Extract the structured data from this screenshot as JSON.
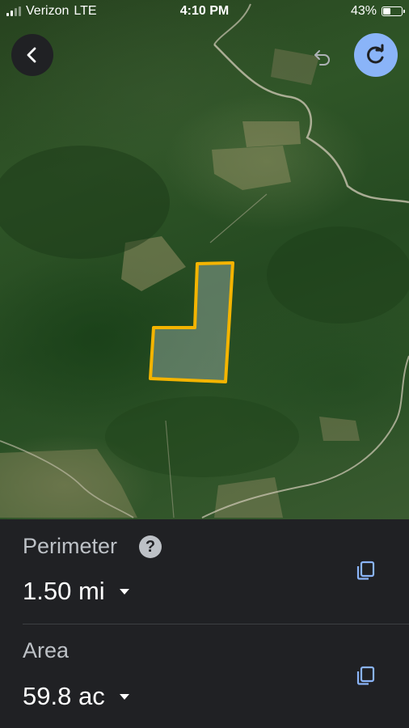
{
  "status_bar": {
    "carrier": "Verizon",
    "network": "LTE",
    "time": "4:10 PM",
    "battery_percent": "43%",
    "battery_level": 0.43,
    "signal_bars": 2
  },
  "toolbar": {
    "back": "back-arrow-icon",
    "undo": "undo-icon",
    "redo": "redo-icon"
  },
  "measurement": {
    "perimeter": {
      "label": "Perimeter",
      "value": "1.50 mi",
      "help_icon": "?"
    },
    "area": {
      "label": "Area",
      "value": "59.8 ac"
    }
  },
  "colors": {
    "panel_bg": "#202124",
    "accent_blue": "#8ab4f8",
    "polygon_outline": "#f4b400"
  }
}
